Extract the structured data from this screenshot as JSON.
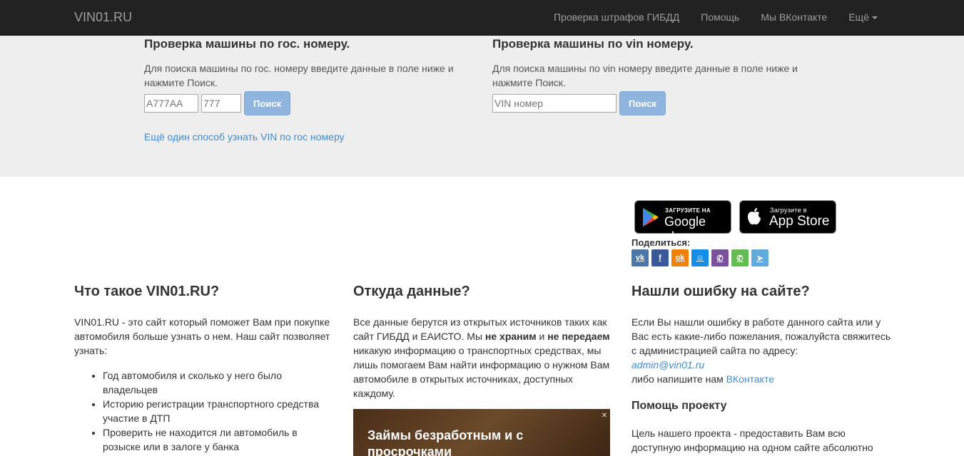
{
  "navbar": {
    "brand": "VIN01.RU",
    "items": [
      "Проверка штрафов ГИБДД",
      "Помощь",
      "Мы ВКонтакте",
      "Ещё"
    ]
  },
  "search_plate": {
    "title": "Проверка машины по гос. номеру.",
    "desc1": "Для поиска машины по гос. номеру введите данные в поле ниже и",
    "desc2": "нажмите Поиск.",
    "number_placeholder": "A777AA",
    "region_placeholder": "777",
    "button": "Поиск",
    "alt_link": "Ещё один способ узнать VIN по гос номеру"
  },
  "search_vin": {
    "title": "Проверка машины по vin номеру.",
    "desc1": "Для поиска машины по vin номеру введите данные в поле ниже и",
    "desc2": "нажмите Поиск.",
    "vin_placeholder": "VIN номер",
    "button": "Поиск"
  },
  "stores": {
    "google_small": "ЗАГРУЗИТЕ НА",
    "google_big": "Google play",
    "apple_small": "Загрузите в",
    "apple_big": "App Store"
  },
  "share": {
    "title": "Поделиться:",
    "buttons": [
      {
        "name": "vk-icon",
        "glyph": "vk",
        "color": "#4a76a8"
      },
      {
        "name": "facebook-icon",
        "glyph": "f",
        "color": "#3b5998"
      },
      {
        "name": "odnoklassniki-icon",
        "glyph": "ok",
        "color": "#ee8208"
      },
      {
        "name": "moimir-icon",
        "glyph": "☺",
        "color": "#168de2"
      },
      {
        "name": "viber-icon",
        "glyph": "✆",
        "color": "#7b519d"
      },
      {
        "name": "whatsapp-icon",
        "glyph": "✆",
        "color": "#65bc54"
      },
      {
        "name": "telegram-icon",
        "glyph": "➤",
        "color": "#64a9dc"
      }
    ]
  },
  "about": {
    "title": "Что такое VIN01.RU?",
    "text": "VIN01.RU - это сайт который поможет Вам при покупке автомобиля больше узнать о нем. Наш сайт позволяет узнать:",
    "items": [
      "Год автомобиля и сколько у него было владельцев",
      "Историю регистрации транспортного средства участие в ДТП",
      "Проверить не находится ли автомобиль в розыске или в залоге у банка"
    ]
  },
  "source": {
    "title": "Откуда данные?",
    "text_a": "Все данные берутся из открытых источников таких как сайт ГИБДД и ЕАИСТО. Мы ",
    "bold1": "не храним",
    "text_b": " и ",
    "bold2": "не передаем",
    "text_c": " никакую информацию о транспортных средствах, мы лишь помогаем Вам найти информацию о нужном Вам автомобиле в открытых источниках, доступных каждому."
  },
  "ad": {
    "text": "Займы безработным и с просрочками",
    "close": "×"
  },
  "error": {
    "title": "Нашли ошибку на сайте?",
    "text": "Если Вы нашли ошибку в работе данного сайта или у Вас есть какие-либо пожелания, пожалуйста свяжитесь с администрацией сайта по адресу:",
    "email": "admin@vin01.ru",
    "text2": "либо напишите нам ",
    "vk_link": "ВКонтакте",
    "help_title": "Помощь проекту",
    "help_text": "Цель нашего проекта - предоставить Вам всю доступную информацию на одном сайте абсолютно"
  }
}
